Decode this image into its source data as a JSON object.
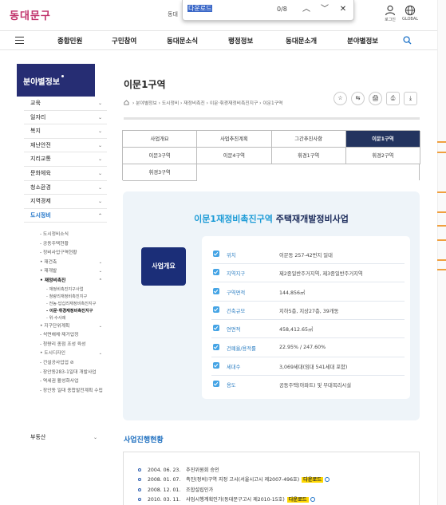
{
  "header": {
    "logo": "동대문구",
    "cutoff_text": "동대",
    "find": {
      "query": "다운로드",
      "count": "0/8"
    },
    "login_label": "로그인",
    "global_label": "GLOBAL"
  },
  "nav": {
    "items": [
      "종합민원",
      "구민참여",
      "동대문소식",
      "행정정보",
      "동대문소개",
      "분야별정보"
    ]
  },
  "sidebar": {
    "title": "분야별정보",
    "items": [
      {
        "label": "교육",
        "chev": "⌄"
      },
      {
        "label": "일자리",
        "chev": "⌄"
      },
      {
        "label": "복지",
        "chev": "⌄"
      },
      {
        "label": "재난안전",
        "chev": "⌄"
      },
      {
        "label": "지리교통",
        "chev": "⌄"
      },
      {
        "label": "문화체육",
        "chev": "⌄"
      },
      {
        "label": "청소환경",
        "chev": "⌄"
      },
      {
        "label": "지역경제",
        "chev": "⌄"
      },
      {
        "label": "도시정비",
        "chev": "⌃"
      }
    ],
    "sub_items": [
      {
        "label": "- 도시정비소식",
        "chev": "",
        "level": "lv2"
      },
      {
        "label": "- 공동주택현황",
        "chev": "",
        "level": "lv2"
      },
      {
        "label": "- 정비사업구역현황",
        "chev": "",
        "level": "lv2"
      },
      {
        "label": "• 재건축",
        "chev": "⌄",
        "level": "lv2"
      },
      {
        "label": "• 재개발",
        "chev": "⌄",
        "level": "lv2"
      },
      {
        "label": "• 재정비촉진",
        "chev": "⌃",
        "level": "lv2 bold"
      },
      {
        "label": "- 재정비촉진지구사업",
        "chev": "",
        "level": "lv3"
      },
      {
        "label": "- 청량리재정비촉진지구",
        "chev": "",
        "level": "lv3"
      },
      {
        "label": "- 전농·답십리재정비촉진지구",
        "chev": "",
        "level": "lv3"
      },
      {
        "label": "- 이문·휘경재정비촉진지구",
        "chev": "",
        "level": "lv3 bold"
      },
      {
        "label": "- 위·수사례",
        "chev": "",
        "level": "lv3"
      },
      {
        "label": "• 지구단위계획",
        "chev": "⌄",
        "level": "lv2"
      },
      {
        "label": "- 석면해체·제거업정",
        "chev": "",
        "level": "lv2"
      },
      {
        "label": "- 청량리 종점 조성 육성",
        "chev": "",
        "level": "lv2"
      },
      {
        "label": "• 도시디자인",
        "chev": "⌄",
        "level": "lv2"
      },
      {
        "label": "- 건설공사업업 ⊘",
        "chev": "",
        "level": "lv2"
      },
      {
        "label": "- 장안동283-1일대 개발사업",
        "chev": "",
        "level": "lv2"
      },
      {
        "label": "- 역세권 활성화사업",
        "chev": "",
        "level": "lv2"
      },
      {
        "label": "- 장안동 일대 종합발전계획 수립",
        "chev": "",
        "level": "lv2"
      }
    ],
    "last_item": {
      "label": "부동산",
      "chev": "⌄"
    }
  },
  "page": {
    "title": "이문1구역",
    "breadcrumb": "› 분야별정보 › 도시정비 › 재정비촉진 › 이문·휘경재정비촉진지구 › 이문1구역",
    "tools": [
      "☆",
      "⇆",
      "🖨",
      "⎙",
      "⤓"
    ]
  },
  "tabs": [
    {
      "label": "사업개요",
      "active": false
    },
    {
      "label": "사업추진계획",
      "active": false
    },
    {
      "label": "그간추진사항",
      "active": false
    },
    {
      "label": "이문1구역",
      "active": true
    },
    {
      "label": "이문3구역",
      "active": false
    },
    {
      "label": "이문4구역",
      "active": false
    },
    {
      "label": "휘경1구역",
      "active": false
    },
    {
      "label": "휘경2구역",
      "active": false
    },
    {
      "label": "휘경3구역",
      "active": false
    }
  ],
  "summary": {
    "title_a": "이문1재정비촉진구역",
    "title_b": " 주택재개발정비사업",
    "badge": "사업개요",
    "rows": [
      {
        "label": "위치",
        "value": "이문동 257-42번지 일대"
      },
      {
        "label": "지역지구",
        "value": "제2종일반주거지역, 제3종일반주거지역"
      },
      {
        "label": "구역면적",
        "value": "144,856㎡"
      },
      {
        "label": "건축규모",
        "value": "지하5층, 지상27층, 39개동"
      },
      {
        "label": "연면적",
        "value": "458,412.65㎡"
      },
      {
        "label": "건폐율/용적률",
        "value": "22.95% / 247.60%"
      },
      {
        "label": "세대수",
        "value": "3,069세대(임대 541세대 포함)"
      },
      {
        "label": "용도",
        "value": "공동주택(아파트) 및 부대복리시설"
      }
    ]
  },
  "progress": {
    "title": "사업진행현황",
    "rows": [
      {
        "date": "2004. 06. 23.",
        "text": "추진위원회 승인",
        "dl": ""
      },
      {
        "date": "2008. 01. 07.",
        "text": "촉진(정비)구역 지정 고시(서울시고시 제2007-496호)",
        "dl": "다운로드"
      },
      {
        "date": "2008. 12. 01.",
        "text": "조합설립인가",
        "dl": ""
      },
      {
        "date": "2010. 03. 11.",
        "text": "사업시행계획인가(동대문구고시 제2010-15호)",
        "dl": "다운로드"
      }
    ]
  }
}
